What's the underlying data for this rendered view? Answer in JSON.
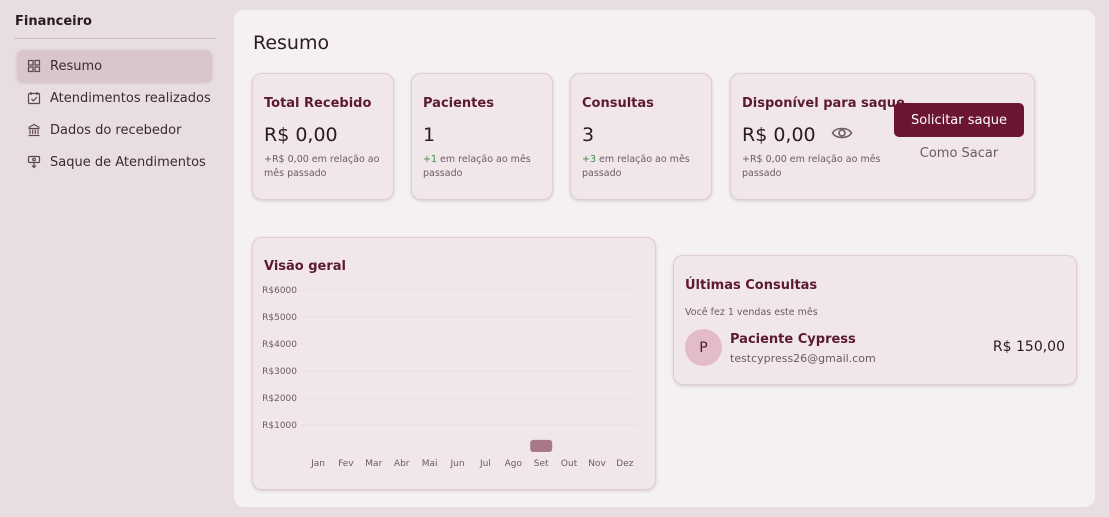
{
  "sidebar": {
    "title": "Financeiro",
    "items": [
      {
        "label": "Resumo",
        "icon": "grid-icon",
        "active": true
      },
      {
        "label": "Atendimentos realizados",
        "icon": "calendar-check-icon",
        "active": false
      },
      {
        "label": "Dados do recebedor",
        "icon": "bank-icon",
        "active": false
      },
      {
        "label": "Saque de Atendimentos",
        "icon": "withdraw-icon",
        "active": false
      }
    ]
  },
  "page": {
    "title": "Resumo"
  },
  "cards": {
    "total": {
      "title": "Total Recebido",
      "value": "R$ 0,00",
      "change": "+R$ 0,00",
      "sub": " em relação ao mês passado"
    },
    "pacientes": {
      "title": "Pacientes",
      "value": "1",
      "change": "+1",
      "sub": " em relação ao mês passado"
    },
    "consultas": {
      "title": "Consultas",
      "value": "3",
      "change": "+3",
      "sub": " em relação ao mês passado"
    },
    "disponivel": {
      "title": "Disponível para saque",
      "value": "R$ 0,00",
      "change": "+R$ 0,00",
      "sub": " em relação ao mês passado",
      "button": "Solicitar saque",
      "link": "Como Sacar"
    }
  },
  "overview": {
    "title": "Visão geral"
  },
  "chart_data": {
    "type": "bar",
    "title": "Visão geral",
    "categories": [
      "Jan",
      "Fev",
      "Mar",
      "Abr",
      "Mai",
      "Jun",
      "Jul",
      "Ago",
      "Set",
      "Out",
      "Nov",
      "Dez"
    ],
    "values": [
      0,
      0,
      0,
      0,
      0,
      0,
      0,
      0,
      450,
      0,
      0,
      0
    ],
    "yticks": [
      "R$6000",
      "R$5000",
      "R$4000",
      "R$3000",
      "R$2000",
      "R$1000"
    ],
    "ytick_values": [
      6000,
      5000,
      4000,
      3000,
      2000,
      1000
    ],
    "ylim": [
      0,
      6000
    ],
    "bar_color": "#a8788a",
    "grid": true
  },
  "latest": {
    "title": "Últimas Consultas",
    "subtitle": "Você fez 1 vendas este mês",
    "entries": [
      {
        "initial": "P",
        "name": "Paciente Cypress",
        "email": "testcypress26@gmail.com",
        "amount": "R$ 150,00"
      }
    ]
  },
  "colors": {
    "accent": "#6b1532",
    "title": "#5c1a31",
    "positive": "#3c8f43"
  }
}
